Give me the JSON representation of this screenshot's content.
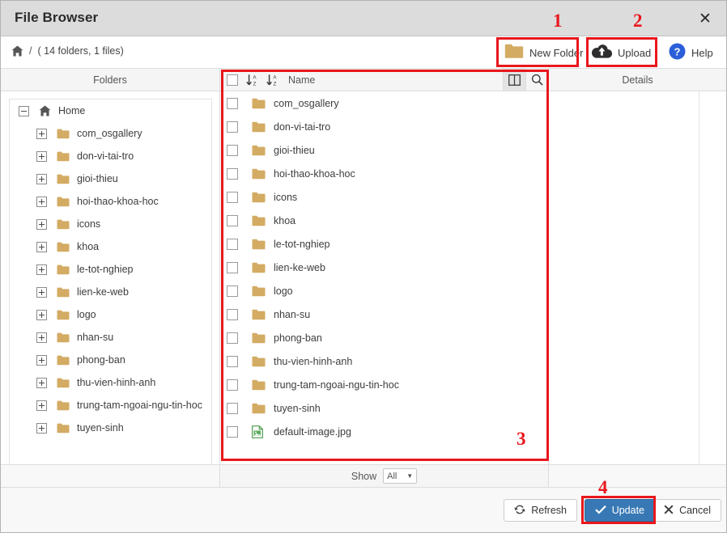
{
  "window": {
    "title": "File Browser",
    "close_label": "✕"
  },
  "breadcrumb": {
    "home_icon": "home-icon",
    "separator": "/",
    "counts": "( 14 folders, 1 files)"
  },
  "toolbar": {
    "new_folder_label": "New Folder",
    "upload_label": "Upload",
    "help_label": "Help"
  },
  "panes": {
    "folders_header": "Folders",
    "name_header": "Name",
    "details_header": "Details"
  },
  "tree": {
    "root": {
      "label": "Home",
      "expander": "minus"
    },
    "items": [
      {
        "label": "com_osgallery"
      },
      {
        "label": "don-vi-tai-tro"
      },
      {
        "label": "gioi-thieu"
      },
      {
        "label": "hoi-thao-khoa-hoc"
      },
      {
        "label": "icons"
      },
      {
        "label": "khoa"
      },
      {
        "label": "le-tot-nghiep"
      },
      {
        "label": "lien-ke-web"
      },
      {
        "label": "logo"
      },
      {
        "label": "nhan-su"
      },
      {
        "label": "phong-ban"
      },
      {
        "label": "thu-vien-hinh-anh"
      },
      {
        "label": "trung-tam-ngoai-ngu-tin-hoc"
      },
      {
        "label": "tuyen-sinh"
      }
    ]
  },
  "files": [
    {
      "name": "com_osgallery",
      "type": "folder"
    },
    {
      "name": "don-vi-tai-tro",
      "type": "folder"
    },
    {
      "name": "gioi-thieu",
      "type": "folder"
    },
    {
      "name": "hoi-thao-khoa-hoc",
      "type": "folder"
    },
    {
      "name": "icons",
      "type": "folder"
    },
    {
      "name": "khoa",
      "type": "folder"
    },
    {
      "name": "le-tot-nghiep",
      "type": "folder"
    },
    {
      "name": "lien-ke-web",
      "type": "folder"
    },
    {
      "name": "logo",
      "type": "folder"
    },
    {
      "name": "nhan-su",
      "type": "folder"
    },
    {
      "name": "phong-ban",
      "type": "folder"
    },
    {
      "name": "thu-vien-hinh-anh",
      "type": "folder"
    },
    {
      "name": "trung-tam-ngoai-ngu-tin-hoc",
      "type": "folder"
    },
    {
      "name": "tuyen-sinh",
      "type": "folder"
    },
    {
      "name": "default-image.jpg",
      "type": "image"
    }
  ],
  "show": {
    "label": "Show",
    "value": "All",
    "caret": "▼"
  },
  "footer": {
    "refresh_label": "Refresh",
    "update_label": "Update",
    "cancel_label": "Cancel"
  },
  "annotations": [
    {
      "number": "1"
    },
    {
      "number": "2"
    },
    {
      "number": "3"
    },
    {
      "number": "4"
    }
  ],
  "colors": {
    "accent_blue": "#3879b5",
    "annotation_red": "#e8171c",
    "folder_gold": "#d3ab63",
    "titlebar_gray": "#dcdcdc"
  }
}
